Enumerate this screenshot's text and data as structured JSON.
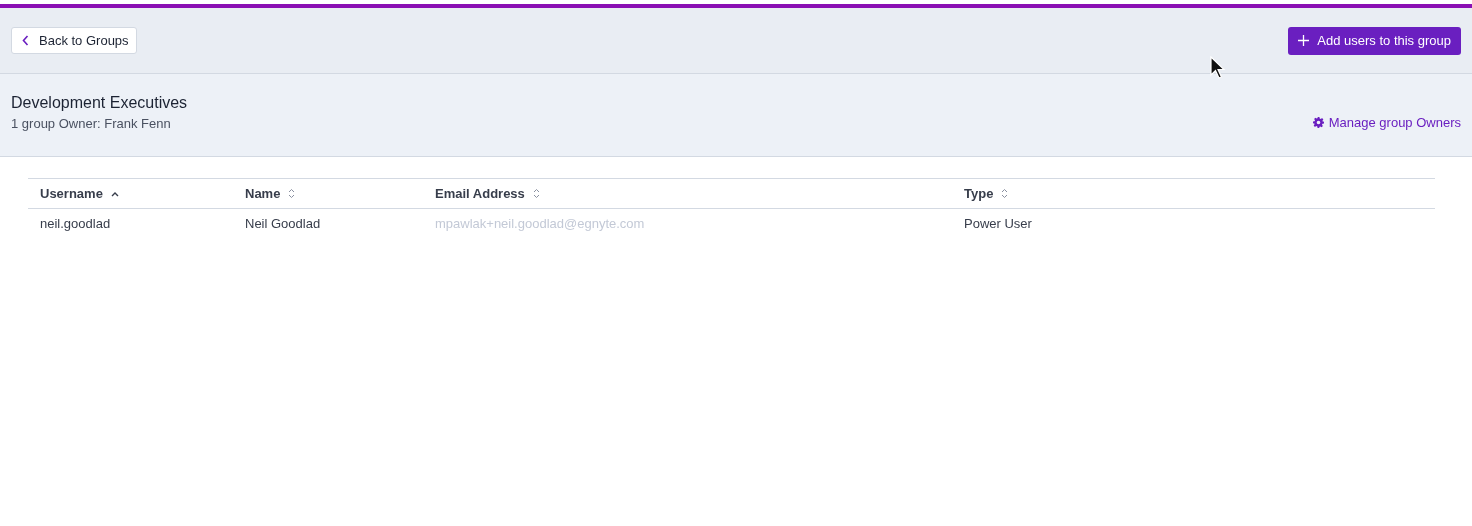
{
  "toolbar": {
    "back_button": "Back to Groups",
    "add_button": "Add users to this group"
  },
  "group": {
    "name": "Development Executives",
    "owners": "1 group Owner: Frank Fenn",
    "manage_link": "Manage group Owners"
  },
  "table": {
    "columns": [
      {
        "label": "Username",
        "sorted": true
      },
      {
        "label": "Name",
        "sorted": false
      },
      {
        "label": "Email Address",
        "sorted": false
      },
      {
        "label": "Type",
        "sorted": false
      }
    ],
    "rows": [
      {
        "cells": [
          {
            "text": "neil.goodlad",
            "muted": false
          },
          {
            "text": "Neil Goodlad",
            "muted": false
          },
          {
            "text": "mpawlak+neil.goodlad@egnyte.com",
            "muted": true
          },
          {
            "text": "Power User",
            "muted": false
          }
        ]
      }
    ]
  }
}
